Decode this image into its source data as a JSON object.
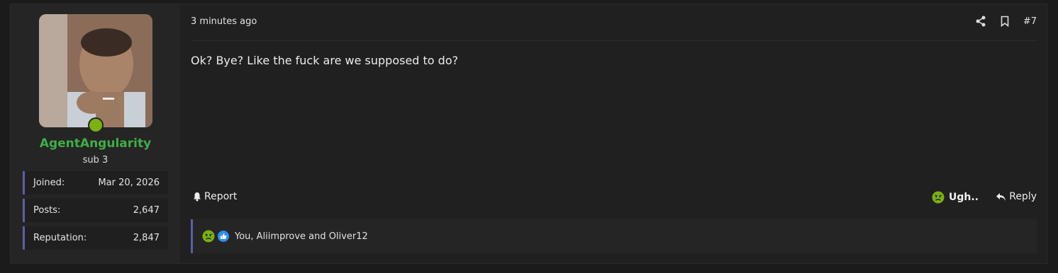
{
  "user": {
    "name": "AgentAngularity",
    "title": "sub 3",
    "stats": [
      {
        "label": "Joined:",
        "value": "Mar 20, 2026"
      },
      {
        "label": "Posts:",
        "value": "2,647"
      },
      {
        "label": "Reputation:",
        "value": "2,847"
      }
    ]
  },
  "post": {
    "time": "3 minutes ago",
    "number": "#7",
    "message": "Ok? Bye? Like the fuck are we supposed to do?",
    "report_label": "Report",
    "reaction_label": "Ugh..",
    "reply_label": "Reply",
    "reactions_summary": "You, Aliimprove and Oliver12"
  },
  "colors": {
    "username": "#3fae46",
    "online": "#7bb20f",
    "accent_bar": "#5b5fa8",
    "like_blue": "#2d8ff0"
  }
}
